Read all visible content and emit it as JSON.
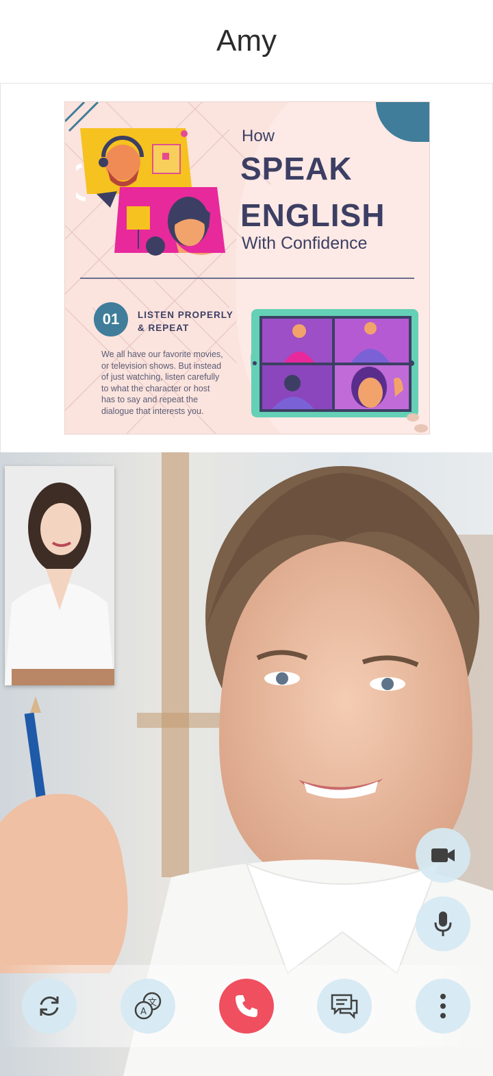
{
  "header": {
    "title": "Amy"
  },
  "slide": {
    "title_how": "How",
    "title_speak": "SPEAK",
    "title_english": "ENGLISH",
    "title_confidence": "With Confidence",
    "step_number": "01",
    "step_title_line1": "LISTEN PROPERLY",
    "step_title_line2": "& REPEAT",
    "paragraph_lines": [
      "We all have our favorite movies,",
      "or television shows. But instead",
      "of just watching, listen carefully",
      "to what the character or host",
      "has to say and repeat the",
      "dialogue that interests you."
    ]
  },
  "controls": {
    "side": [
      {
        "name": "camera-toggle-button",
        "icon": "video-camera-icon"
      },
      {
        "name": "mute-button",
        "icon": "microphone-icon"
      }
    ],
    "bottom": [
      {
        "name": "switch-camera-button",
        "icon": "refresh-icon"
      },
      {
        "name": "translate-button",
        "icon": "translate-icon"
      },
      {
        "name": "end-call-button",
        "icon": "phone-icon",
        "color": "#ef4f5f"
      },
      {
        "name": "chat-button",
        "icon": "chat-icon"
      },
      {
        "name": "more-options-button",
        "icon": "more-vertical-icon"
      }
    ]
  },
  "colors": {
    "slide_background": "#fbe3de",
    "navy_text": "#3c3f63",
    "teal_accent": "#3f7d9a",
    "control_background": "#d5e8f2",
    "end_call_red": "#ef4f5f"
  }
}
